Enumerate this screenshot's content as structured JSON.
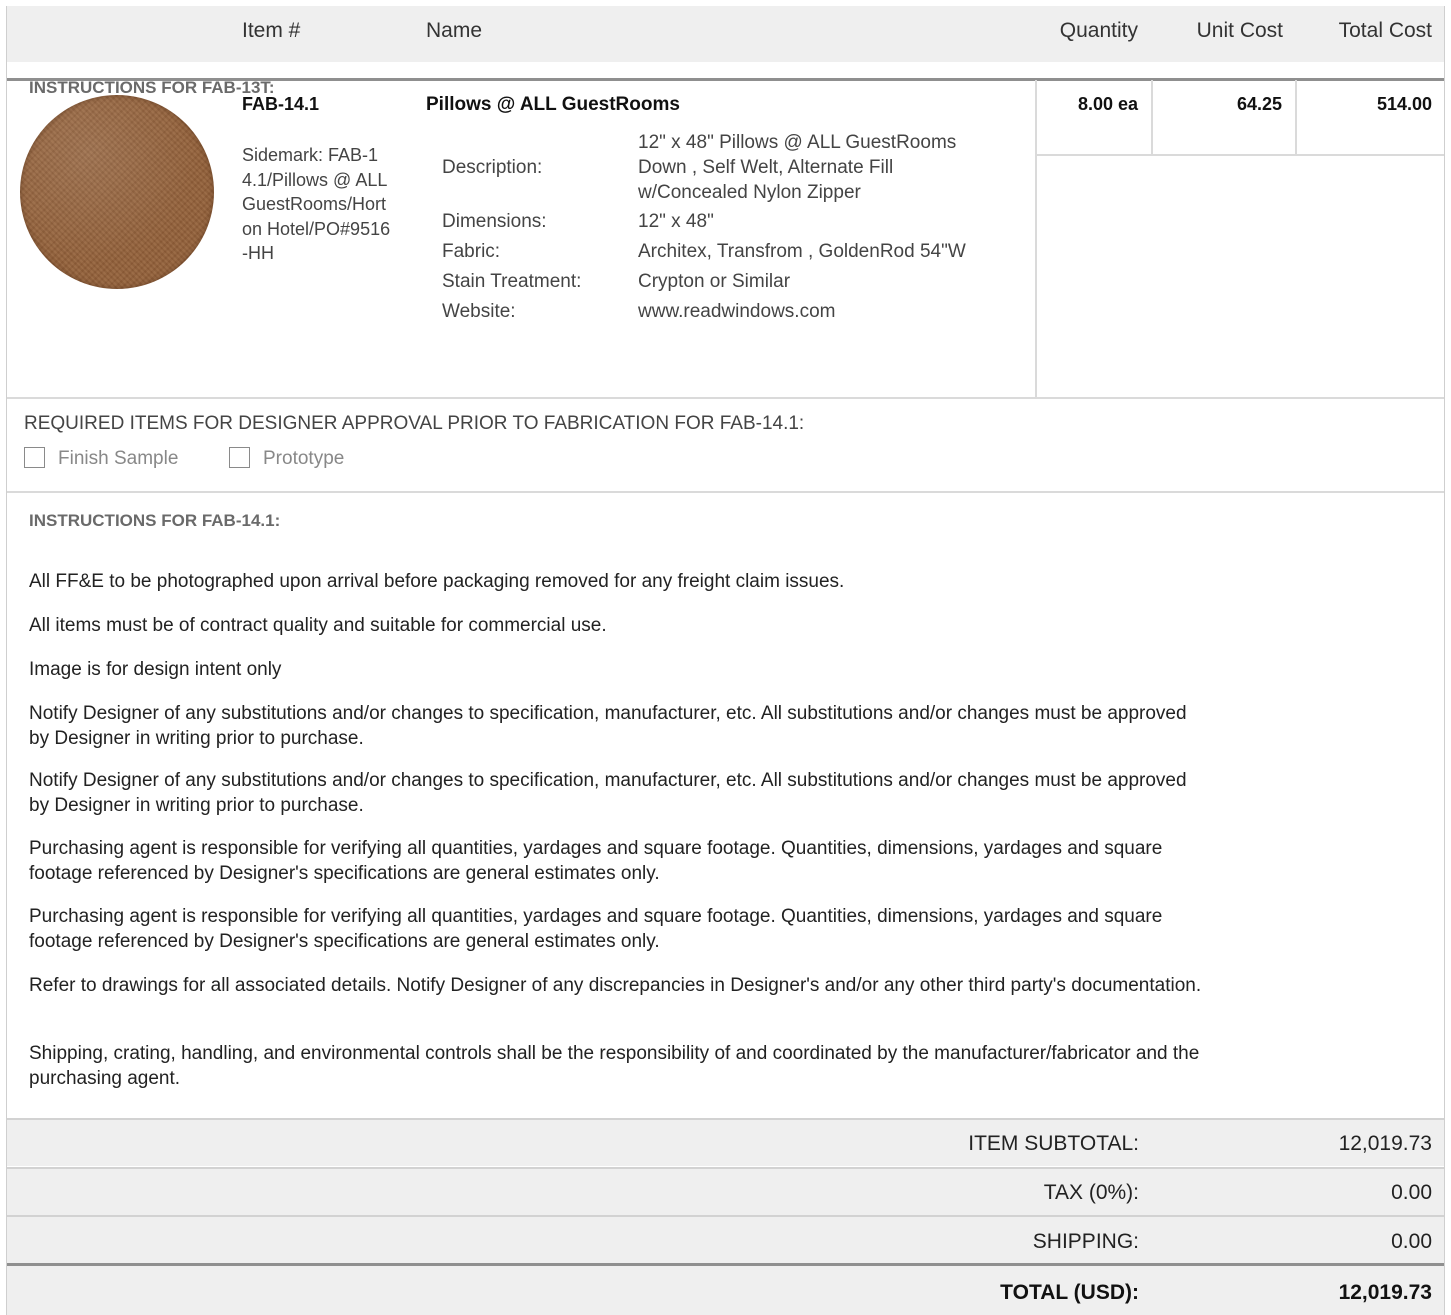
{
  "header": {
    "item_num": "Item #",
    "name": "Name",
    "quantity": "Quantity",
    "unit_cost": "Unit Cost",
    "total_cost": "Total Cost"
  },
  "overlap_instructions": "INSTRUCTIONS FOR FAB-13T:",
  "item": {
    "number": "FAB-14.1",
    "name": "Pillows @ ALL GuestRooms",
    "sidemark": "Sidemark: FAB-14.1/Pillows @ ALL GuestRooms/Horton Hotel/PO#9516-HH",
    "quantity": "8.00 ea",
    "unit_cost": "64.25",
    "total_cost": "514.00",
    "image_icon": "fabric-swatch-goldenrod",
    "specs": {
      "description_label": "Description:",
      "description_value_1": "12\" x 48\" Pillows @ ALL GuestRooms",
      "description_value_2": "Down , Self Welt, Alternate Fill",
      "description_value_3": "w/Concealed Nylon Zipper",
      "dimensions_label": "Dimensions:",
      "dimensions_value": "12\" x 48\"",
      "fabric_label": "Fabric:",
      "fabric_value": "Architex, Transfrom , GoldenRod 54\"W",
      "stain_label": "Stain Treatment:",
      "stain_value": "Crypton or Similar",
      "website_label": "Website:",
      "website_value": "www.readwindows.com"
    }
  },
  "approval": {
    "title": "REQUIRED ITEMS FOR DESIGNER APPROVAL PRIOR TO FABRICATION FOR FAB-14.1:",
    "finish_sample": "Finish Sample",
    "prototype": "Prototype",
    "finish_sample_checked": false,
    "prototype_checked": false
  },
  "instructions": {
    "title": "INSTRUCTIONS FOR FAB-14.1:",
    "p1": "All FF&E to be photographed upon arrival before packaging removed for any freight claim issues.",
    "p2": "All items must be of contract quality and suitable for commercial use.",
    "p3": "Image is for design intent only",
    "p4": "Notify Designer of any substitutions and/or changes to specification, manufacturer, etc. All substitutions and/or  changes must be approved by Designer in writing prior to purchase.",
    "p5": "Notify Designer of any substitutions and/or changes to specification, manufacturer, etc. All substitutions and/or  changes must be approved by Designer in writing prior to purchase.",
    "p6": "Purchasing agent is responsible for verifying all quantities, yardages and square footage. Quantities, dimensions, yardages and square footage referenced by Designer's specifications are general estimates only.",
    "p7": "Purchasing agent is responsible for verifying all quantities, yardages and square footage. Quantities, dimensions, yardages and square footage referenced by Designer's specifications are general estimates only.",
    "p8": "Refer to drawings for all associated details. Notify Designer of any discrepancies in Designer's and/or any other third party's documentation.",
    "p9": "Shipping, crating, handling, and environmental controls shall be the responsibility of and coordinated by the manufacturer/fabricator and the purchasing agent."
  },
  "totals": {
    "subtotal_label": "ITEM SUBTOTAL:",
    "subtotal_value": "12,019.73",
    "tax_label": "TAX (0%):",
    "tax_value": "0.00",
    "shipping_label": "SHIPPING:",
    "shipping_value": "0.00",
    "total_label": "TOTAL (USD):",
    "total_value": "12,019.73"
  }
}
